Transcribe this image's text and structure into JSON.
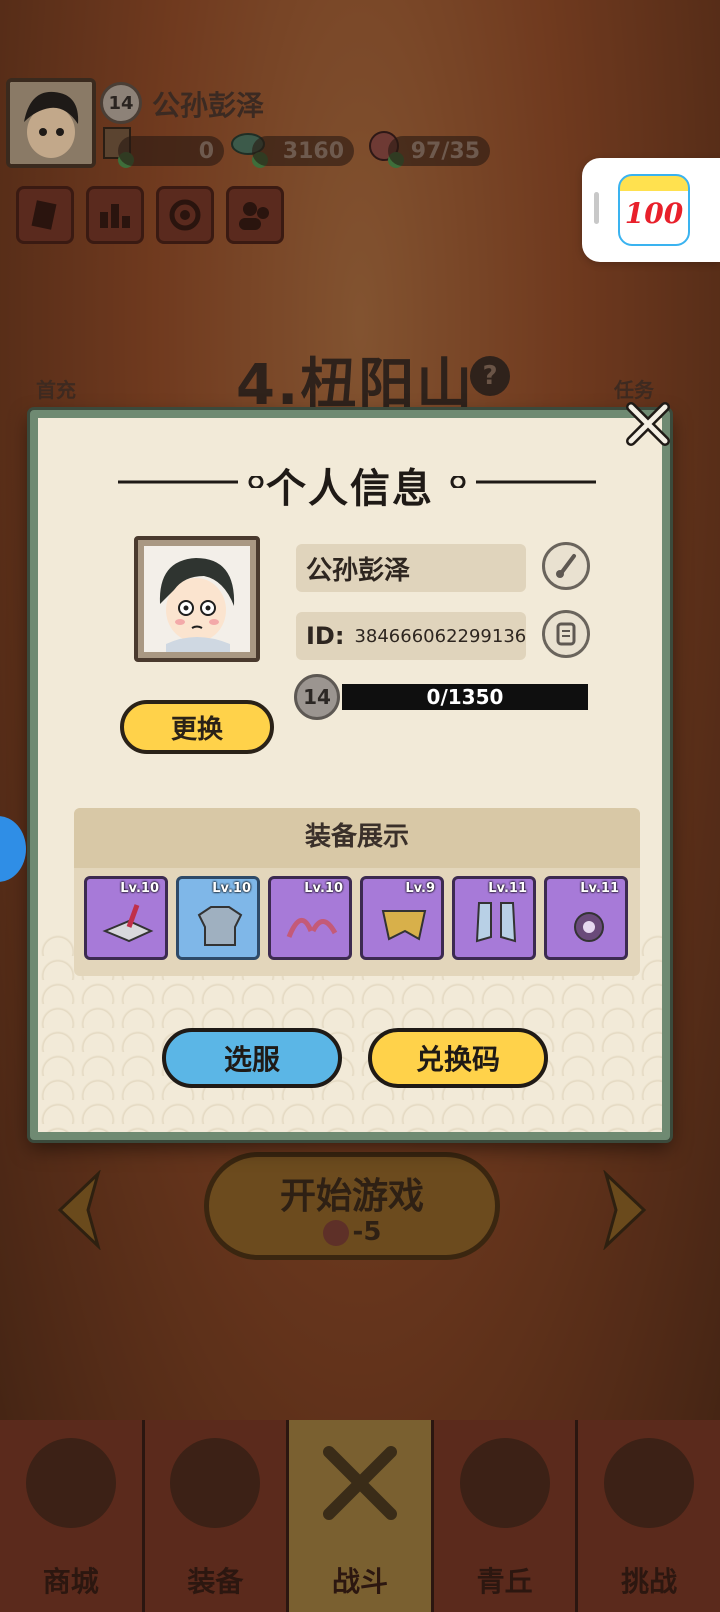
{
  "player": {
    "level": "14",
    "name": "公孙彭泽",
    "resource_1": "0",
    "resource_2": "3160",
    "stamina": "97/35"
  },
  "scene": {
    "stage_title": "4.杻阳山",
    "left_label": "首充",
    "right_label": "任务",
    "start_button": "开始游戏",
    "start_cost": "-5"
  },
  "nav": {
    "items": [
      {
        "label": "商城"
      },
      {
        "label": "装备"
      },
      {
        "label": "战斗"
      },
      {
        "label": "青丘"
      },
      {
        "label": "挑战"
      }
    ],
    "active_index": 2
  },
  "floating_app": {
    "icon_text": "100"
  },
  "modal": {
    "title": "个人信息",
    "name": "公孙彭泽",
    "id_label": "ID:",
    "id_value": "384666062299136",
    "level": "14",
    "xp_text": "0/1350",
    "change_button": "更换",
    "equip_title": "装备展示",
    "equipment": [
      {
        "level": "Lv.10",
        "rarity": "purple",
        "icon": "anvil-icon"
      },
      {
        "level": "Lv.10",
        "rarity": "blue",
        "icon": "armor-icon"
      },
      {
        "level": "Lv.10",
        "rarity": "purple",
        "icon": "horns-icon"
      },
      {
        "level": "Lv.9",
        "rarity": "purple",
        "icon": "cloak-icon"
      },
      {
        "level": "Lv.11",
        "rarity": "purple",
        "icon": "boots-icon"
      },
      {
        "level": "Lv.11",
        "rarity": "purple",
        "icon": "orb-icon"
      }
    ],
    "server_button": "选服",
    "redeem_button": "兑换码"
  },
  "colors": {
    "modal_border": "#6f8a72",
    "yellow_button": "#ffd24a",
    "blue_button": "#5bb6e6",
    "purple_rarity": "#a77ad8",
    "blue_rarity": "#7fb7e8"
  }
}
